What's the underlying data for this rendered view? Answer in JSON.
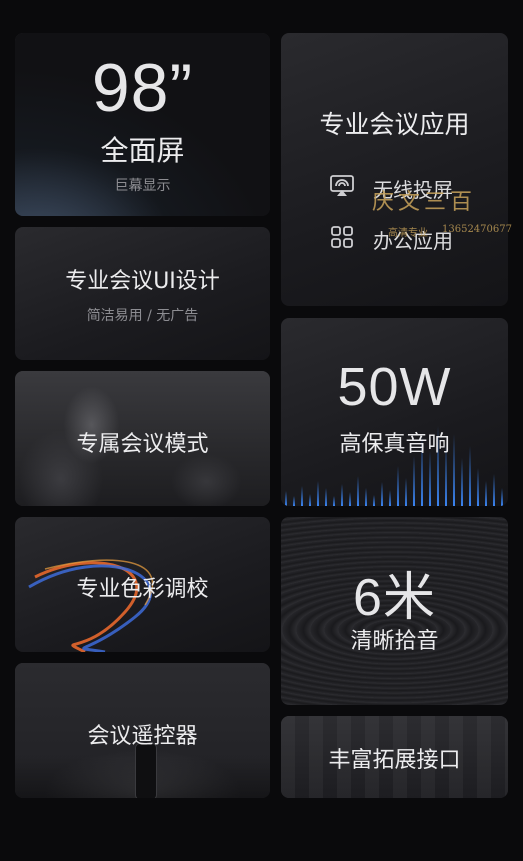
{
  "cards": {
    "screen": {
      "size": "98”",
      "title": "全面屏",
      "subtitle": "巨幕显示"
    },
    "apps": {
      "title": "专业会议应用",
      "features": [
        {
          "icon": "screen-cast-icon",
          "label": "无线投屏"
        },
        {
          "icon": "grid-apps-icon",
          "label": "办公应用"
        }
      ]
    },
    "ui": {
      "title": "专业会议UI设计",
      "subtitle": "简洁易用 / 无广告"
    },
    "mode": {
      "title": "专属会议模式"
    },
    "audio": {
      "value": "50W",
      "title": "高保真音响"
    },
    "color": {
      "title": "专业色彩调校"
    },
    "mic": {
      "value": "6米",
      "title": "清晰拾音"
    },
    "remote": {
      "title": "会议遥控器"
    },
    "ports": {
      "title": "丰富拓展接口"
    }
  },
  "watermark": {
    "main": "庆文三百",
    "sub": "高清专业",
    "phone": "13652470677"
  },
  "colors": {
    "background": "#0a0a0c",
    "card": "#222226",
    "accent_blue": "#3d8bff",
    "watermark": "#c8a35a"
  }
}
